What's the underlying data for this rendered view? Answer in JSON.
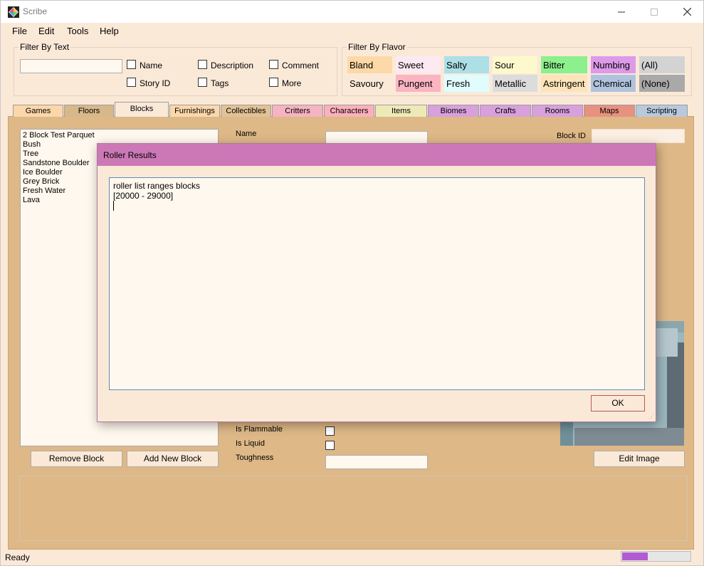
{
  "window": {
    "title": "Scribe"
  },
  "menu": [
    "File",
    "Edit",
    "Tools",
    "Help"
  ],
  "filter_text": {
    "label": "Filter By Text",
    "value": "",
    "checkboxes": [
      {
        "label": "Name",
        "checked": false
      },
      {
        "label": "Description",
        "checked": false
      },
      {
        "label": "Comment",
        "checked": false
      },
      {
        "label": "Story ID",
        "checked": false
      },
      {
        "label": "Tags",
        "checked": false
      },
      {
        "label": "More",
        "checked": false
      }
    ]
  },
  "filter_flavor": {
    "label": "Filter By Flavor",
    "flavors": [
      {
        "label": "Bland",
        "color": "#fdd9a7"
      },
      {
        "label": "Sweet",
        "color": "#fde9f2"
      },
      {
        "label": "Salty",
        "color": "#acdfe6"
      },
      {
        "label": "Sour",
        "color": "#fdf9cd"
      },
      {
        "label": "Bitter",
        "color": "#8cf08c"
      },
      {
        "label": "Numbing",
        "color": "#dd9ae8"
      },
      {
        "label": "(All)",
        "color": "#d3d3d3"
      },
      {
        "label": "Savoury",
        "color": "#fbe9d8"
      },
      {
        "label": "Pungent",
        "color": "#fbb4c1"
      },
      {
        "label": "Fresh",
        "color": "#e0fcfd"
      },
      {
        "label": "Metallic",
        "color": "#dcdcdc"
      },
      {
        "label": "Astringent",
        "color": "#fde4b8"
      },
      {
        "label": "Chemical",
        "color": "#b0c3dd"
      },
      {
        "label": "(None)",
        "color": "#a9a9a9"
      }
    ]
  },
  "tabs": [
    {
      "label": "Games",
      "color": "#fbd7aa",
      "active": false
    },
    {
      "label": "Floors",
      "color": "#d6b88a",
      "active": false
    },
    {
      "label": "Blocks",
      "color": "#fbe9d8",
      "active": true
    },
    {
      "label": "Furnishings",
      "color": "#fbd7aa",
      "active": false
    },
    {
      "label": "Collectibles",
      "color": "#e1c296",
      "active": false
    },
    {
      "label": "Critters",
      "color": "#f6b3c2",
      "active": false
    },
    {
      "label": "Characters",
      "color": "#fbb0be",
      "active": false
    },
    {
      "label": "Items",
      "color": "#eeeab8",
      "active": false
    },
    {
      "label": "Biomes",
      "color": "#d8a0dd",
      "active": false
    },
    {
      "label": "Crafts",
      "color": "#d8a0dd",
      "active": false
    },
    {
      "label": "Rooms",
      "color": "#d8a0dd",
      "active": false
    },
    {
      "label": "Maps",
      "color": "#e7917f",
      "active": false
    },
    {
      "label": "Scripting",
      "color": "#b8c9de",
      "active": false
    }
  ],
  "blocks_list": [
    "2 Block Test Parquet",
    "Bush",
    "Tree",
    "Sandstone Boulder",
    "Ice Boulder",
    "Grey Brick",
    "Fresh Water",
    "Lava"
  ],
  "buttons": {
    "remove": "Remove Block",
    "add": "Add New Block",
    "edit_image": "Edit Image"
  },
  "form": {
    "name_label": "Name",
    "name_value": "",
    "block_id_label": "Block ID",
    "block_id_value": "",
    "flammable_label": "Is Flammable",
    "liquid_label": "Is Liquid",
    "toughness_label": "Toughness",
    "toughness_value": ""
  },
  "dialog": {
    "title": "Roller Results",
    "line1": "roller list ranges blocks",
    "line2": "[20000 - 29000]",
    "ok": "OK"
  },
  "status": {
    "text": "Ready",
    "progress": 0.37
  }
}
